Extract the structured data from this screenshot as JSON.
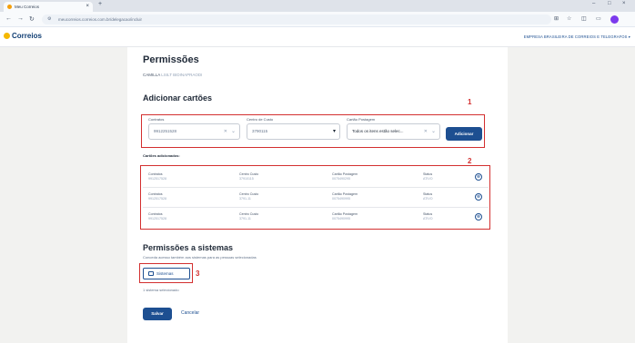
{
  "browser": {
    "tab_title": "Meu Correios",
    "url": "meucorreios.correios.com.br/delegacao/incluir",
    "new_tab": "+",
    "close": "×",
    "min": "–",
    "max": "□",
    "win_close": "×"
  },
  "header": {
    "logo_text": "Correios",
    "org": "EMPRESA BRASILEIRA DE CORREIOS E TELEGRAFOS ▾"
  },
  "page": {
    "title": "Permissões",
    "user_first": "CAMILLA",
    "user_rest": "LSILT BIDINAPRAODI"
  },
  "add_cards": {
    "title": "Adicionar cartões",
    "contratos_label": "Contratos",
    "contratos_value": "9912251528",
    "centro_label": "Centro de Custo",
    "centro_value": "3790115",
    "cartao_label": "Cartão Postagem",
    "cartao_value": "Todos os itens estão selec...",
    "add_button": "Adicionar",
    "marker": "1"
  },
  "added": {
    "title": "Cartões adicionados:",
    "marker": "2",
    "rows": [
      {
        "c1l": "Contratos",
        "c1v": "9912517528",
        "c2l": "Centro Custo",
        "c2v": "37910115",
        "c3l": "Cartão Postagem",
        "c3v": "0075490295",
        "c4l": "Status",
        "c4v": "ATIVO"
      },
      {
        "c1l": "Contratos",
        "c1v": "9912517528",
        "c2l": "Centro Custo",
        "c2v": "3791-11",
        "c3l": "Cartão Postagem",
        "c3v": "0075490995",
        "c4l": "Status",
        "c4v": "ATIVO"
      },
      {
        "c1l": "Contratos",
        "c1v": "9912517528",
        "c2l": "Centro Custo",
        "c2v": "3791-11",
        "c3l": "Cartão Postagem",
        "c3v": "0075490995",
        "c4l": "Status",
        "c4v": "ATIVO"
      }
    ]
  },
  "systems": {
    "title": "Permissões a sistemas",
    "desc": "Conceda acesso também aos sistemas para as pessoas selecionadas",
    "button": "Sistemas",
    "marker": "3",
    "selected": "1 sistema selecionado"
  },
  "footer": {
    "save": "Salvar",
    "cancel": "Cancelar"
  },
  "colors": {
    "brand_blue": "#1d4f91",
    "highlight_red": "#d32f2f",
    "logo_yellow": "#f5b800"
  }
}
